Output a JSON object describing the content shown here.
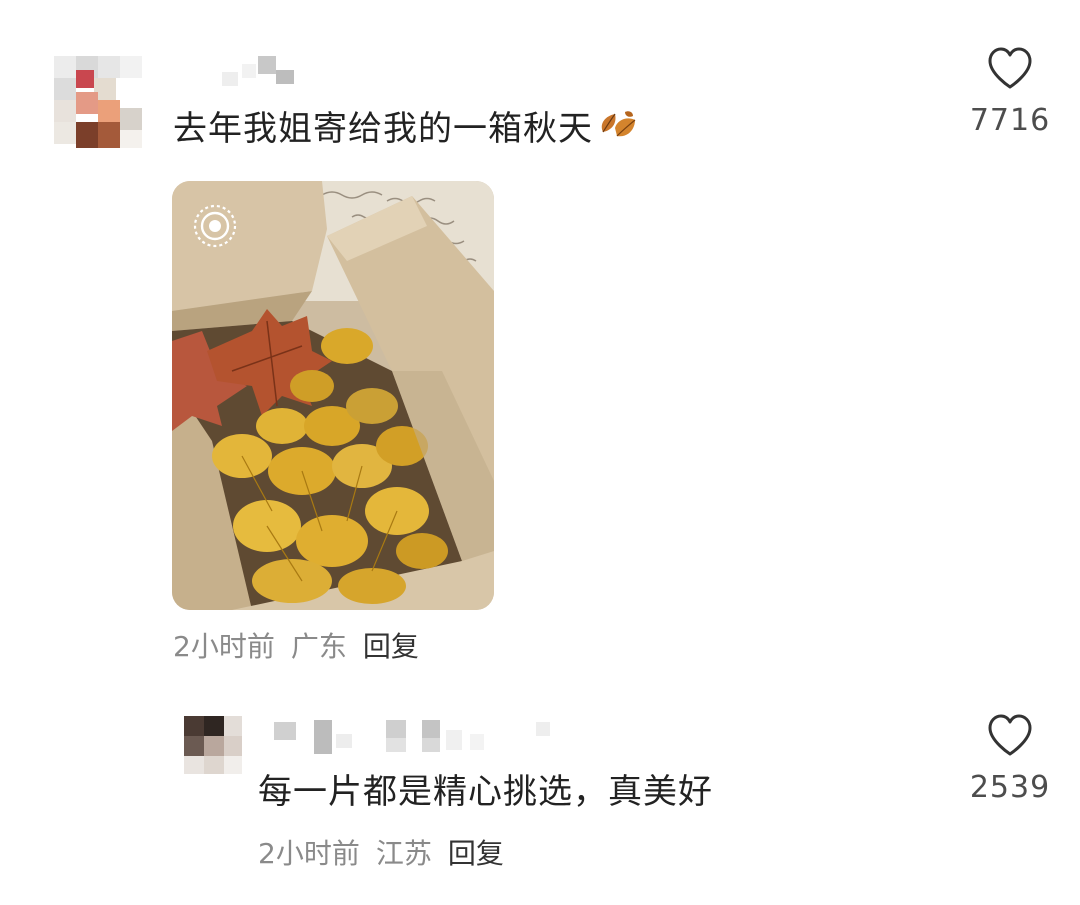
{
  "comments": [
    {
      "text": "去年我姐寄给我的一箱秋天",
      "emoji_icon": "fallen-leaf-icon",
      "time": "2小时前",
      "region": "广东",
      "reply_label": "回复",
      "likes": "7716",
      "image_badge_icon": "live-photo-icon"
    },
    {
      "text": "每一片都是精心挑选，真美好",
      "time": "2小时前",
      "region": "江苏",
      "reply_label": "回复",
      "likes": "2539"
    }
  ],
  "colors": {
    "text_primary": "#222222",
    "text_meta": "#8a8a8a",
    "text_reply": "#333333",
    "like_count": "#4d4d4d",
    "heart_stroke": "#333333"
  }
}
